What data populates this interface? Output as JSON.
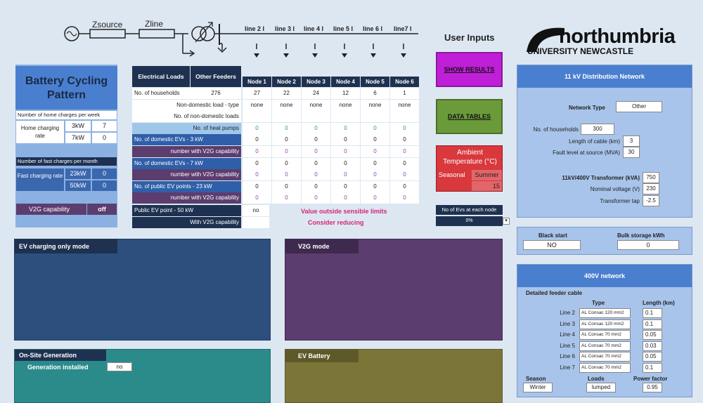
{
  "circuit": {
    "z_source": "Zsource",
    "z_line": "Zline",
    "lines": [
      "line 2 I",
      "line 3 I",
      "line 4 I",
      "line 5 I",
      "line 6 I",
      "line7 I"
    ]
  },
  "user_inputs": "User Inputs",
  "buttons": {
    "show_results": "SHOW RESULTS",
    "data_tables": "DATA TABLES"
  },
  "logo": {
    "name": "northumbria",
    "sub": "UNIVERSITY NEWCASTLE"
  },
  "battery": {
    "title": "Battery Cycling Pattern",
    "home_week_label": "Number of home charges per week",
    "home_rate_label": "Home charging rate",
    "home_rows": [
      {
        "p": "3kW",
        "v": "7"
      },
      {
        "p": "7kW",
        "v": "0"
      }
    ],
    "fast_month_label": "Number of fast charges per month",
    "fast_rate_label": "Fast charging rate",
    "fast_rows": [
      {
        "p": "23kW",
        "v": "0"
      },
      {
        "p": "50kW",
        "v": "0"
      }
    ],
    "v2g_label": "V2G capability",
    "v2g_value": "off"
  },
  "loads": {
    "col_electrical": "Electrical Loads",
    "col_other": "Other Feeders",
    "nodes": [
      "Node 1",
      "Node 2",
      "Node 3",
      "Node 4",
      "Node 5",
      "Node 6"
    ],
    "rows": [
      {
        "label": "No. of households",
        "other": "276",
        "vals": [
          "27",
          "22",
          "24",
          "12",
          "6",
          "1"
        ]
      },
      {
        "label": "Non-domestic load - type",
        "other": "",
        "vals": [
          "none",
          "none",
          "none",
          "none",
          "none",
          "none"
        ]
      },
      {
        "label": "No. of non-domestic loads",
        "other": "",
        "vals": [
          "",
          "",
          "",
          "",
          "",
          ""
        ]
      },
      {
        "label": "No. of heat pumps",
        "other": "",
        "vals": [
          "0",
          "0",
          "0",
          "0",
          "0",
          "0"
        ]
      },
      {
        "label": "No. of domestic EVs  - 3 kW",
        "other": "",
        "vals": [
          "0",
          "0",
          "0",
          "0",
          "0",
          "0"
        ]
      },
      {
        "label": "number with V2G capability",
        "other": "",
        "vals": [
          "0",
          "0",
          "0",
          "0",
          "0",
          "0"
        ]
      },
      {
        "label": "No. of domestic EVs  - 7 kW",
        "other": "",
        "vals": [
          "0",
          "0",
          "0",
          "0",
          "0",
          "0"
        ]
      },
      {
        "label": "number with V2G capability",
        "other": "",
        "vals": [
          "0",
          "0",
          "0",
          "0",
          "0",
          "0"
        ]
      },
      {
        "label": "No. of public EV points  - 23 kW",
        "other": "",
        "vals": [
          "0",
          "0",
          "0",
          "0",
          "0",
          "0"
        ]
      },
      {
        "label": "number with V2G capability",
        "other": "",
        "vals": [
          "0",
          "0",
          "0",
          "0",
          "0",
          "0"
        ]
      }
    ],
    "public50_label": "Public EV point - 50 kW",
    "public50_value": "no",
    "withv2g_label": "With V2G capability",
    "warn1": "Value outside sensible limits",
    "warn2": "Consider reducing"
  },
  "ambient": {
    "title": "Ambient Temperature (°C)",
    "seasonal": "Seasonal",
    "season": "Summer",
    "temp": "15"
  },
  "evs_node": {
    "label": "No of Evs at each node",
    "value": "0%"
  },
  "network11": {
    "title": "11 kV Distribution Network",
    "type_label": "Network Type",
    "type_value": "Other",
    "households_label": "No. of households",
    "households_value": "300",
    "cable_label": "Length of cable (km)",
    "cable_value": "3",
    "fault_label": "Fault level at source (MVA)",
    "fault_value": "30",
    "trans_label": "11kV/400V Transformer (kVA)",
    "trans_value": "750",
    "volt_label": "Nominal voltage (V)",
    "volt_value": "230",
    "tap_label": "Transformer tap",
    "tap_value": "-2.5"
  },
  "black_start": {
    "label": "Black start",
    "value": "NO"
  },
  "bulk": {
    "label": "Bulk storage kWh",
    "value": "0"
  },
  "lv": {
    "title": "400V network",
    "feeder": "Detailed feeder cable",
    "col_type": "Type",
    "col_len": "Length (km)",
    "lines": [
      {
        "name": "Line 2",
        "type": "AL Consac 120 mm2",
        "len": "0.1"
      },
      {
        "name": "Line 3",
        "type": "AL Consac 120 mm2",
        "len": "0.1"
      },
      {
        "name": "Line 4",
        "type": "AL Consac 70 mm2",
        "len": "0.05"
      },
      {
        "name": "Line 5",
        "type": "AL Consac 70 mm2",
        "len": "0.03"
      },
      {
        "name": "Line 6",
        "type": "AL Consac 70 mm2",
        "len": "0.05"
      },
      {
        "name": "Line 7",
        "type": "AL Consac 70 mm2",
        "len": "0.1"
      }
    ],
    "season_label": "Season",
    "season_value": "Winter",
    "loads_label": "Loads",
    "loads_value": "lumped",
    "pf_label": "Power factor",
    "pf_value": "0.95"
  },
  "panels": {
    "ev_only": "EV charging only mode",
    "v2g": "V2G mode",
    "onsite": "On-Site Generation",
    "gen_label": "Generation installed",
    "gen_value": "no",
    "ev_battery": "EV Battery"
  },
  "colors": {
    "accent_blue": "#4a7fcf",
    "navy": "#1e3150",
    "magenta": "#c01fd8",
    "green": "#6b9a3a",
    "red": "#d9383c",
    "warn": "#d4267a"
  }
}
